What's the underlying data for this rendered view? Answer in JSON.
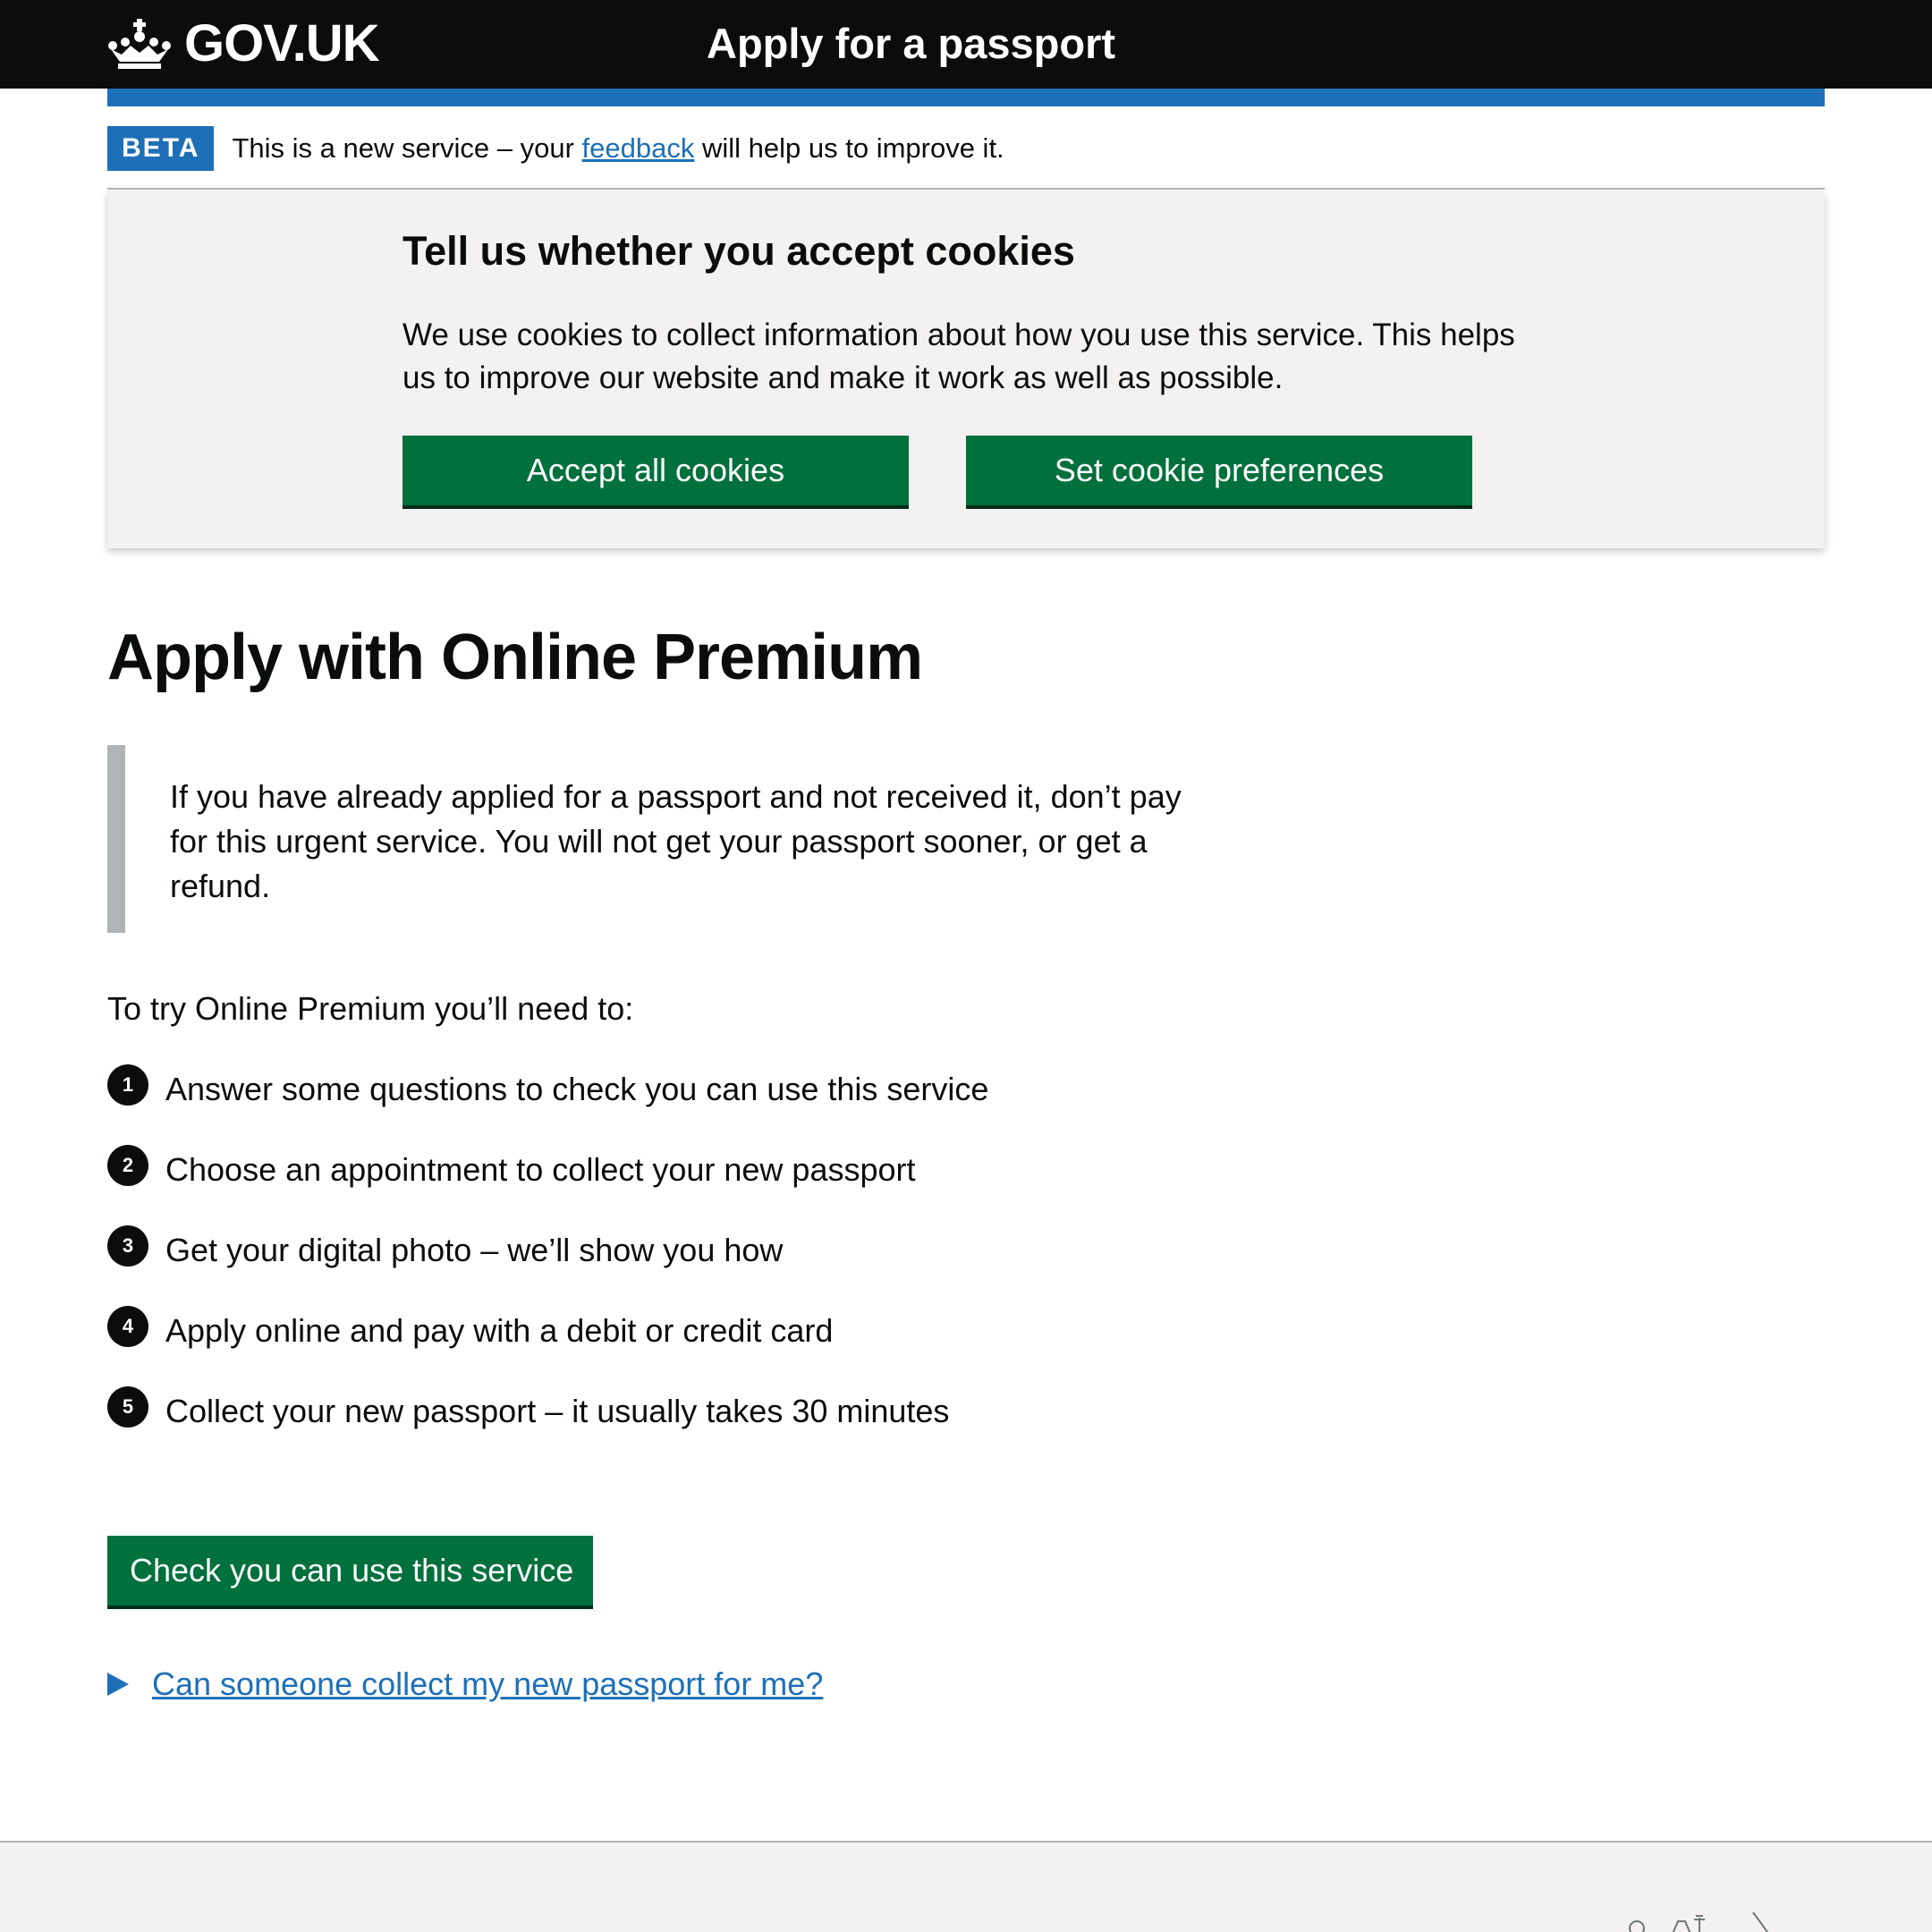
{
  "header": {
    "logo_text": "GOV.UK",
    "service_name": "Apply for a passport"
  },
  "phase_banner": {
    "tag": "BETA",
    "text_before": "This is a new service – your ",
    "link_text": "feedback",
    "text_after": " will help us to improve it."
  },
  "cookie_banner": {
    "heading": "Tell us whether you accept cookies",
    "text": "We use cookies to collect information about how you use this service. This helps us to improve our website and make it work as well as possible.",
    "accept_label": "Accept all cookies",
    "preferences_label": "Set cookie preferences"
  },
  "main": {
    "title": "Apply with Online Premium",
    "inset_text": "If you have already applied for a passport and not received it, don’t pay for this urgent service. You will not get your passport sooner, or get a refund.",
    "intro": "To try Online Premium you’ll need to:",
    "steps": [
      {
        "number": "1",
        "text": "Answer some questions to check you can use this service"
      },
      {
        "number": "2",
        "text": "Choose an appointment to collect your new passport"
      },
      {
        "number": "3",
        "text": "Get your digital photo – we’ll show you how"
      },
      {
        "number": "4",
        "text": "Apply online and pay with a debit or credit card"
      },
      {
        "number": "5",
        "text": "Collect your new passport – it usually takes 30 minutes"
      }
    ],
    "start_button": "Check you can use this service",
    "details_summary": "Can someone collect my new passport for me?"
  },
  "colors": {
    "header_bg": "#0b0c0c",
    "brand_blue": "#1d70b8",
    "button_green": "#00703c",
    "panel_grey": "#f3f2f1"
  }
}
